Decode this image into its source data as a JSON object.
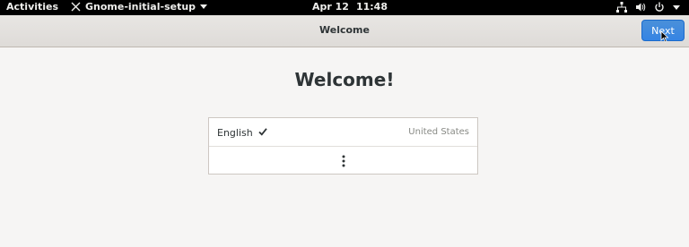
{
  "topbar": {
    "activities": "Activities",
    "app_name": "Gnome-initial-setup",
    "date": "Apr 12",
    "time": "11:48"
  },
  "headerbar": {
    "title": "Welcome",
    "next_label": "Next"
  },
  "main": {
    "heading": "Welcome!",
    "languages": [
      {
        "name": "English",
        "region": "United States",
        "selected": true
      }
    ]
  },
  "colors": {
    "accent": "#3584e4",
    "topbar_bg": "#000000",
    "window_bg": "#f6f5f4"
  },
  "icons": [
    "app-icon",
    "caret-down-icon",
    "network-icon",
    "volume-icon",
    "power-icon",
    "checkmark-icon",
    "more-icon",
    "cursor-icon"
  ]
}
